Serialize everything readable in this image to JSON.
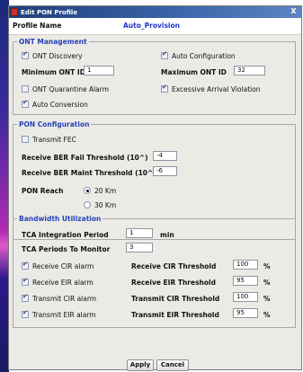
{
  "window": {
    "title": "Edit PON Profile",
    "close_symbol": "X"
  },
  "profile": {
    "label": "Profile Name",
    "value": "Auto_Provision"
  },
  "ont_management": {
    "legend": "ONT Management",
    "ont_discovery": {
      "label": "ONT Discovery",
      "checked": true
    },
    "auto_configuration": {
      "label": "Auto Configuration",
      "checked": true
    },
    "min_ont_id": {
      "label": "Minimum ONT ID",
      "value": "1"
    },
    "max_ont_id": {
      "label": "Maximum ONT ID",
      "value": "32"
    },
    "ont_quarantine_alarm": {
      "label": "ONT Quarantine Alarm",
      "checked": false
    },
    "excessive_arrival_violation": {
      "label": "Excessive Arrival Violation",
      "checked": true
    },
    "auto_conversion": {
      "label": "Auto Conversion",
      "checked": true
    }
  },
  "pon_configuration": {
    "legend": "PON Configuration",
    "transmit_fec": {
      "label": "Transmit FEC",
      "checked": false
    },
    "ber_fail": {
      "label": "Receive BER Fail Threshold (10^)",
      "value": "-4"
    },
    "ber_maint": {
      "label": "Receive BER Maint Threshold (10^)",
      "value": "-6"
    },
    "pon_reach": {
      "label": "PON Reach",
      "options": [
        "20 Km",
        "30 Km"
      ],
      "selected": "20 Km"
    }
  },
  "bandwidth": {
    "legend": "Bandwidth Utilization",
    "tca_integration": {
      "label": "TCA Integration Period",
      "value": "1",
      "unit": "min"
    },
    "tca_periods": {
      "label": "TCA Periods To Monitor",
      "value": "3"
    },
    "rows": [
      {
        "alarm_label": "Receive CIR alarm",
        "checked": true,
        "threshold_label": "Receive CIR Threshold",
        "value": "100",
        "unit": "%"
      },
      {
        "alarm_label": "Receive EIR alarm",
        "checked": true,
        "threshold_label": "Receive EIR Threshold",
        "value": "95",
        "unit": "%"
      },
      {
        "alarm_label": "Transmit CIR alarm",
        "checked": true,
        "threshold_label": "Transmit CIR Threshold",
        "value": "100",
        "unit": "%"
      },
      {
        "alarm_label": "Transmit EIR alarm",
        "checked": true,
        "threshold_label": "Transmit EIR Threshold",
        "value": "95",
        "unit": "%"
      }
    ]
  },
  "buttons": {
    "apply": "Apply",
    "cancel": "Cancel"
  }
}
